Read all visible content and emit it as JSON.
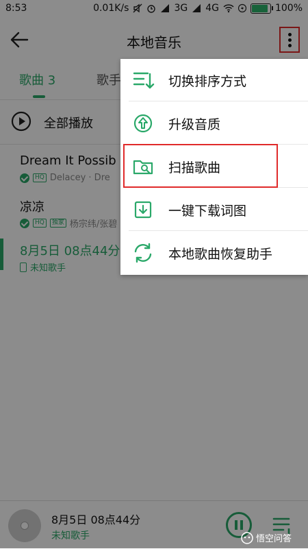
{
  "status_bar": {
    "time": "8:53",
    "speed": "0.01K/s",
    "network_3g": "3G",
    "network_4g": "4G",
    "battery": "100%",
    "battery_level": 1.0
  },
  "header": {
    "title": "本地音乐"
  },
  "tabs": [
    {
      "label": "歌曲 3",
      "active": true
    },
    {
      "label": "歌手",
      "active": false
    }
  ],
  "play_all": {
    "label": "全部播放"
  },
  "songs": [
    {
      "title": "Dream It Possib",
      "artist": "Delacey · Dre",
      "tags": [
        "HQ"
      ]
    },
    {
      "title": "凉凉",
      "artist": "杨宗纬/张碧",
      "tags": [
        "HQ",
        "独家"
      ]
    },
    {
      "title": "8月5日 08点44分",
      "artist": "未知歌手",
      "tags": [],
      "current": true
    }
  ],
  "menu": {
    "items": [
      {
        "label": "切换排序方式",
        "icon": "sort-icon"
      },
      {
        "label": "升级音质",
        "icon": "upgrade-icon"
      },
      {
        "label": "扫描歌曲",
        "icon": "folder-search-icon",
        "highlighted": true
      },
      {
        "label": "一键下载词图",
        "icon": "download-icon"
      },
      {
        "label": "本地歌曲恢复助手",
        "icon": "restore-icon"
      }
    ]
  },
  "player": {
    "title": "8月5日 08点44分",
    "artist": "未知歌手"
  },
  "watermark": {
    "text": "悟空问答"
  },
  "colors": {
    "accent": "#2aa869",
    "highlight": "#e02a2a"
  }
}
